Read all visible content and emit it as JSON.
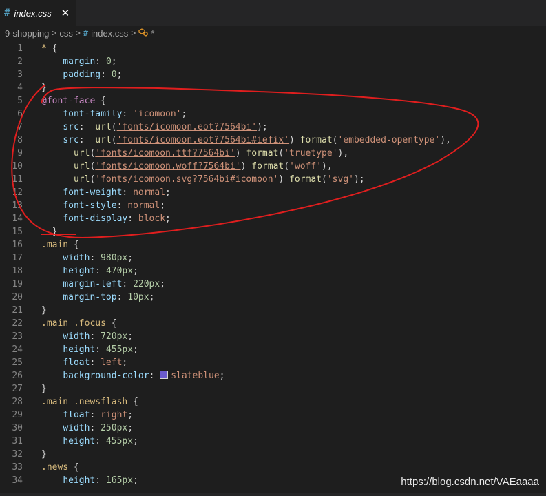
{
  "tab": {
    "icon": "#",
    "title": "index.css",
    "close_label": "✕"
  },
  "breadcrumb": {
    "items": [
      "9-shopping",
      "css",
      "index.css",
      "*"
    ],
    "separator": ">"
  },
  "colors": {
    "accent": "#519aba",
    "annotation": "#e01e1e",
    "swatch": "#6a5acd"
  },
  "lines": [
    {
      "n": "1",
      "parts": [
        [
          "sel",
          "* "
        ],
        [
          "p",
          "{"
        ]
      ]
    },
    {
      "n": "2",
      "parts": [
        [
          "sp",
          "    "
        ],
        [
          "prop",
          "margin"
        ],
        [
          "p",
          ": "
        ],
        [
          "num",
          "0"
        ],
        [
          "p",
          ";"
        ]
      ]
    },
    {
      "n": "3",
      "parts": [
        [
          "sp",
          "    "
        ],
        [
          "prop",
          "padding"
        ],
        [
          "p",
          ": "
        ],
        [
          "num",
          "0"
        ],
        [
          "p",
          ";"
        ]
      ]
    },
    {
      "n": "4",
      "parts": [
        [
          "p",
          "}"
        ]
      ]
    },
    {
      "n": "5",
      "parts": [
        [
          "at",
          "@font-face "
        ],
        [
          "p",
          "{"
        ]
      ]
    },
    {
      "n": "6",
      "parts": [
        [
          "sp",
          "    "
        ],
        [
          "prop",
          "font-family"
        ],
        [
          "p",
          ": "
        ],
        [
          "val",
          "'icomoon'"
        ],
        [
          "p",
          ";"
        ]
      ]
    },
    {
      "n": "7",
      "parts": [
        [
          "sp",
          "    "
        ],
        [
          "prop",
          "src"
        ],
        [
          "p",
          ":  "
        ],
        [
          "fn",
          "url"
        ],
        [
          "p",
          "("
        ],
        [
          "url",
          "'fonts/icomoon.eot?7564bi'"
        ],
        [
          "p",
          ");"
        ]
      ]
    },
    {
      "n": "8",
      "parts": [
        [
          "sp",
          "    "
        ],
        [
          "prop",
          "src"
        ],
        [
          "p",
          ":  "
        ],
        [
          "fn",
          "url"
        ],
        [
          "p",
          "("
        ],
        [
          "url",
          "'fonts/icomoon.eot?7564bi#iefix'"
        ],
        [
          "p",
          ") "
        ],
        [
          "fn",
          "format"
        ],
        [
          "p",
          "("
        ],
        [
          "val",
          "'embedded-opentype'"
        ],
        [
          "p",
          "),"
        ]
      ]
    },
    {
      "n": "9",
      "parts": [
        [
          "sp",
          "      "
        ],
        [
          "fn",
          "url"
        ],
        [
          "p",
          "("
        ],
        [
          "url",
          "'fonts/icomoon.ttf?7564bi'"
        ],
        [
          "p",
          ") "
        ],
        [
          "fn",
          "format"
        ],
        [
          "p",
          "("
        ],
        [
          "val",
          "'truetype'"
        ],
        [
          "p",
          "),"
        ]
      ]
    },
    {
      "n": "10",
      "parts": [
        [
          "sp",
          "      "
        ],
        [
          "fn",
          "url"
        ],
        [
          "p",
          "("
        ],
        [
          "url",
          "'fonts/icomoon.woff?7564bi'"
        ],
        [
          "p",
          ") "
        ],
        [
          "fn",
          "format"
        ],
        [
          "p",
          "("
        ],
        [
          "val",
          "'woff'"
        ],
        [
          "p",
          "),"
        ]
      ]
    },
    {
      "n": "11",
      "parts": [
        [
          "sp",
          "      "
        ],
        [
          "fn",
          "url"
        ],
        [
          "p",
          "("
        ],
        [
          "url",
          "'fonts/icomoon.svg?7564bi#icomoon'"
        ],
        [
          "p",
          ") "
        ],
        [
          "fn",
          "format"
        ],
        [
          "p",
          "("
        ],
        [
          "val",
          "'svg'"
        ],
        [
          "p",
          ");"
        ]
      ]
    },
    {
      "n": "12",
      "parts": [
        [
          "sp",
          "    "
        ],
        [
          "prop",
          "font-weight"
        ],
        [
          "p",
          ": "
        ],
        [
          "val",
          "normal"
        ],
        [
          "p",
          ";"
        ]
      ]
    },
    {
      "n": "13",
      "parts": [
        [
          "sp",
          "    "
        ],
        [
          "prop",
          "font-style"
        ],
        [
          "p",
          ": "
        ],
        [
          "val",
          "normal"
        ],
        [
          "p",
          ";"
        ]
      ]
    },
    {
      "n": "14",
      "parts": [
        [
          "sp",
          "    "
        ],
        [
          "prop",
          "font-display"
        ],
        [
          "p",
          ": "
        ],
        [
          "val",
          "block"
        ],
        [
          "p",
          ";"
        ]
      ]
    },
    {
      "n": "15",
      "parts": [
        [
          "sp",
          "  "
        ],
        [
          "p",
          "}"
        ]
      ]
    },
    {
      "n": "16",
      "parts": [
        [
          "sel",
          ".main "
        ],
        [
          "p",
          "{"
        ]
      ]
    },
    {
      "n": "17",
      "parts": [
        [
          "sp",
          "    "
        ],
        [
          "prop",
          "width"
        ],
        [
          "p",
          ": "
        ],
        [
          "num",
          "980px"
        ],
        [
          "p",
          ";"
        ]
      ]
    },
    {
      "n": "18",
      "parts": [
        [
          "sp",
          "    "
        ],
        [
          "prop",
          "height"
        ],
        [
          "p",
          ": "
        ],
        [
          "num",
          "470px"
        ],
        [
          "p",
          ";"
        ]
      ]
    },
    {
      "n": "19",
      "parts": [
        [
          "sp",
          "    "
        ],
        [
          "prop",
          "margin-left"
        ],
        [
          "p",
          ": "
        ],
        [
          "num",
          "220px"
        ],
        [
          "p",
          ";"
        ]
      ]
    },
    {
      "n": "20",
      "parts": [
        [
          "sp",
          "    "
        ],
        [
          "prop",
          "margin-top"
        ],
        [
          "p",
          ": "
        ],
        [
          "num",
          "10px"
        ],
        [
          "p",
          ";"
        ]
      ]
    },
    {
      "n": "21",
      "parts": [
        [
          "p",
          "}"
        ]
      ]
    },
    {
      "n": "22",
      "parts": [
        [
          "sel",
          ".main .focus "
        ],
        [
          "p",
          "{"
        ]
      ]
    },
    {
      "n": "23",
      "parts": [
        [
          "sp",
          "    "
        ],
        [
          "prop",
          "width"
        ],
        [
          "p",
          ": "
        ],
        [
          "num",
          "720px"
        ],
        [
          "p",
          ";"
        ]
      ]
    },
    {
      "n": "24",
      "parts": [
        [
          "sp",
          "    "
        ],
        [
          "prop",
          "height"
        ],
        [
          "p",
          ": "
        ],
        [
          "num",
          "455px"
        ],
        [
          "p",
          ";"
        ]
      ]
    },
    {
      "n": "25",
      "parts": [
        [
          "sp",
          "    "
        ],
        [
          "prop",
          "float"
        ],
        [
          "p",
          ": "
        ],
        [
          "val",
          "left"
        ],
        [
          "p",
          ";"
        ]
      ]
    },
    {
      "n": "26",
      "parts": [
        [
          "sp",
          "    "
        ],
        [
          "prop",
          "background-color"
        ],
        [
          "p",
          ": "
        ],
        [
          "swatch",
          ""
        ],
        [
          "val",
          "slateblue"
        ],
        [
          "p",
          ";"
        ]
      ]
    },
    {
      "n": "27",
      "parts": [
        [
          "p",
          "}"
        ]
      ]
    },
    {
      "n": "28",
      "parts": [
        [
          "sel",
          ".main .newsflash "
        ],
        [
          "p",
          "{"
        ]
      ]
    },
    {
      "n": "29",
      "parts": [
        [
          "sp",
          "    "
        ],
        [
          "prop",
          "float"
        ],
        [
          "p",
          ": "
        ],
        [
          "val",
          "right"
        ],
        [
          "p",
          ";"
        ]
      ]
    },
    {
      "n": "30",
      "parts": [
        [
          "sp",
          "    "
        ],
        [
          "prop",
          "width"
        ],
        [
          "p",
          ": "
        ],
        [
          "num",
          "250px"
        ],
        [
          "p",
          ";"
        ]
      ]
    },
    {
      "n": "31",
      "parts": [
        [
          "sp",
          "    "
        ],
        [
          "prop",
          "height"
        ],
        [
          "p",
          ": "
        ],
        [
          "num",
          "455px"
        ],
        [
          "p",
          ";"
        ]
      ]
    },
    {
      "n": "32",
      "parts": [
        [
          "p",
          "}"
        ]
      ]
    },
    {
      "n": "33",
      "parts": [
        [
          "sel",
          ".news "
        ],
        [
          "p",
          "{"
        ]
      ]
    },
    {
      "n": "34",
      "parts": [
        [
          "sp",
          "    "
        ],
        [
          "prop",
          "height"
        ],
        [
          "p",
          ": "
        ],
        [
          "num",
          "165px"
        ],
        [
          "p",
          ";"
        ]
      ]
    }
  ],
  "watermark": "https://blog.csdn.net/VAEaaaa"
}
